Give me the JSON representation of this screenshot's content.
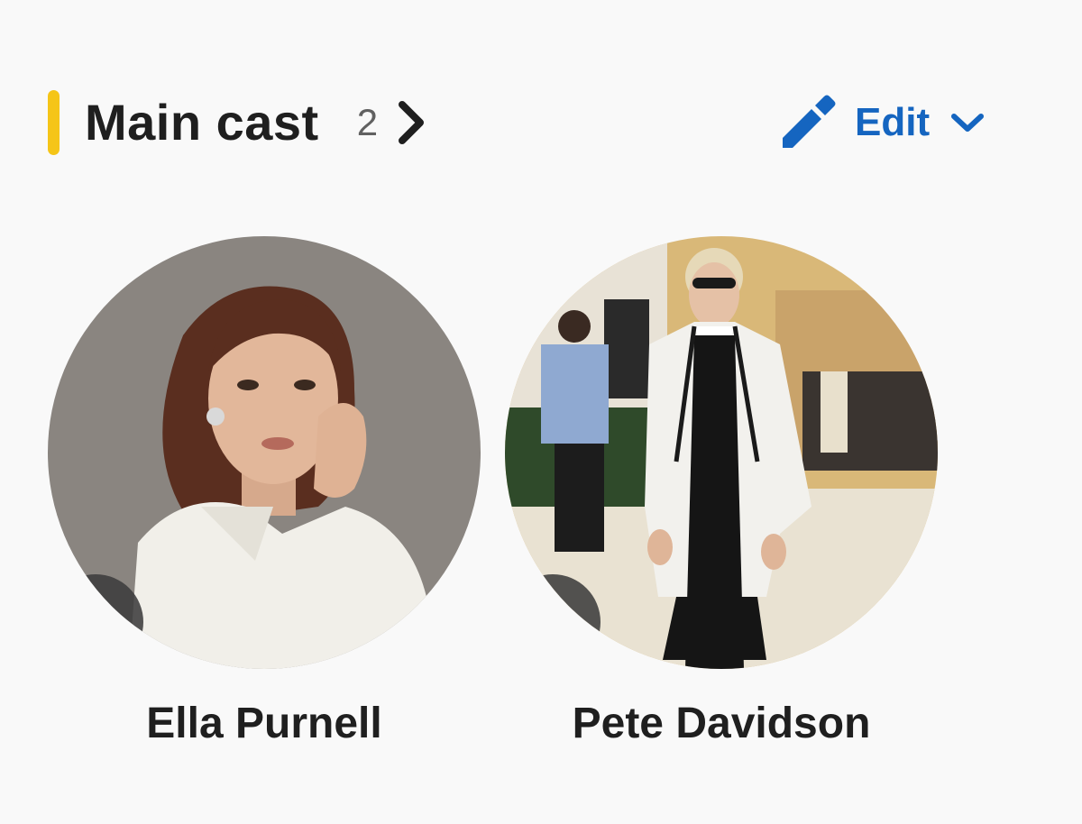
{
  "section": {
    "title": "Main cast",
    "count": "2",
    "edit_label": "Edit",
    "accent_color": "#f5c518",
    "link_color": "#1565c0"
  },
  "icons": {
    "chevron": "chevron-right-icon",
    "edit": "pencil-icon",
    "dropdown": "chevron-down-icon",
    "add": "plus-icon"
  },
  "cast": [
    {
      "name": "Ella Purnell"
    },
    {
      "name": "Pete Davidson"
    }
  ]
}
